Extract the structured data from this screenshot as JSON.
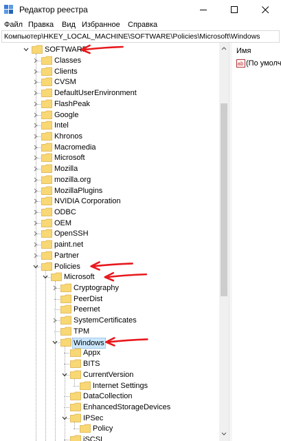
{
  "window": {
    "title": "Редактор реестра",
    "minimize_label": "Свернуть",
    "maximize_label": "Развернуть",
    "close_label": "Закрыть"
  },
  "menu": [
    "Файл",
    "Правка",
    "Вид",
    "Избранное",
    "Справка"
  ],
  "address": "Компьютер\\HKEY_LOCAL_MACHINE\\SOFTWARE\\Policies\\Microsoft\\Windows",
  "tree": [
    {
      "label": "SOFTWARE",
      "level": 0,
      "expander": "expanded",
      "arrow": true
    },
    {
      "label": "Classes",
      "level": 1,
      "expander": "collapsed"
    },
    {
      "label": "Clients",
      "level": 1,
      "expander": "collapsed"
    },
    {
      "label": "CVSM",
      "level": 1,
      "expander": "collapsed"
    },
    {
      "label": "DefaultUserEnvironment",
      "level": 1,
      "expander": "collapsed"
    },
    {
      "label": "FlashPeak",
      "level": 1,
      "expander": "collapsed"
    },
    {
      "label": "Google",
      "level": 1,
      "expander": "collapsed"
    },
    {
      "label": "Intel",
      "level": 1,
      "expander": "collapsed"
    },
    {
      "label": "Khronos",
      "level": 1,
      "expander": "collapsed"
    },
    {
      "label": "Macromedia",
      "level": 1,
      "expander": "collapsed"
    },
    {
      "label": "Microsoft",
      "level": 1,
      "expander": "collapsed"
    },
    {
      "label": "Mozilla",
      "level": 1,
      "expander": "collapsed"
    },
    {
      "label": "mozilla.org",
      "level": 1,
      "expander": "collapsed"
    },
    {
      "label": "MozillaPlugins",
      "level": 1,
      "expander": "collapsed"
    },
    {
      "label": "NVIDIA Corporation",
      "level": 1,
      "expander": "collapsed"
    },
    {
      "label": "ODBC",
      "level": 1,
      "expander": "collapsed"
    },
    {
      "label": "OEM",
      "level": 1,
      "expander": "collapsed"
    },
    {
      "label": "OpenSSH",
      "level": 1,
      "expander": "collapsed"
    },
    {
      "label": "paint.net",
      "level": 1,
      "expander": "collapsed"
    },
    {
      "label": "Partner",
      "level": 1,
      "expander": "collapsed"
    },
    {
      "label": "Policies",
      "level": 1,
      "expander": "expanded",
      "arrow": true
    },
    {
      "label": "Microsoft",
      "level": 2,
      "expander": "expanded",
      "arrow": true
    },
    {
      "label": "Cryptography",
      "level": 3,
      "expander": "collapsed"
    },
    {
      "label": "PeerDist",
      "level": 3,
      "expander": "none"
    },
    {
      "label": "Peernet",
      "level": 3,
      "expander": "none"
    },
    {
      "label": "SystemCertificates",
      "level": 3,
      "expander": "collapsed"
    },
    {
      "label": "TPM",
      "level": 3,
      "expander": "none"
    },
    {
      "label": "Windows",
      "level": 3,
      "expander": "expanded",
      "selected": true,
      "arrow": true
    },
    {
      "label": "Appx",
      "level": 4,
      "expander": "none"
    },
    {
      "label": "BITS",
      "level": 4,
      "expander": "none"
    },
    {
      "label": "CurrentVersion",
      "level": 4,
      "expander": "expanded"
    },
    {
      "label": "Internet Settings",
      "level": 5,
      "expander": "none"
    },
    {
      "label": "DataCollection",
      "level": 4,
      "expander": "none"
    },
    {
      "label": "EnhancedStorageDevices",
      "level": 4,
      "expander": "none"
    },
    {
      "label": "IPSec",
      "level": 4,
      "expander": "expanded"
    },
    {
      "label": "Policy",
      "level": 5,
      "expander": "none"
    },
    {
      "label": "iSCSI",
      "level": 4,
      "expander": "none"
    }
  ],
  "values_pane": {
    "column_header": "Имя",
    "rows": [
      {
        "icon": "string-value-icon",
        "name": "(По умолч"
      }
    ]
  },
  "colors": {
    "folder": "#f8d775",
    "folder_edge": "#dcb04a",
    "selection": "#cce8ff",
    "annotation_arrow": "#e8181c"
  }
}
